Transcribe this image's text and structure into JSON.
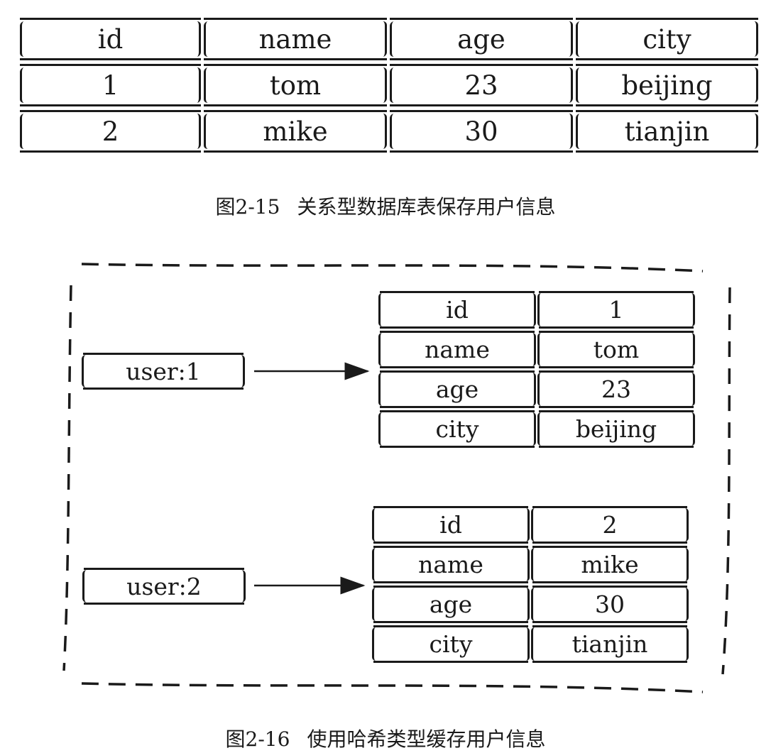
{
  "relational_table": {
    "columns": [
      "id",
      "name",
      "age",
      "city"
    ],
    "rows": [
      [
        "1",
        "tom",
        "23",
        "beijing"
      ],
      [
        "2",
        "mike",
        "30",
        "tianjin"
      ]
    ]
  },
  "caption_15": {
    "number": "图2-15",
    "text": "关系型数据库表保存用户信息"
  },
  "hash": {
    "entries": [
      {
        "key": "user:1",
        "fields": [
          {
            "field": "id",
            "value": "1"
          },
          {
            "field": "name",
            "value": "tom"
          },
          {
            "field": "age",
            "value": "23"
          },
          {
            "field": "city",
            "value": "beijing"
          }
        ]
      },
      {
        "key": "user:2",
        "fields": [
          {
            "field": "id",
            "value": "2"
          },
          {
            "field": "name",
            "value": "mike"
          },
          {
            "field": "age",
            "value": "30"
          },
          {
            "field": "city",
            "value": "tianjin"
          }
        ]
      }
    ]
  },
  "caption_16": {
    "number": "图2-16",
    "text": "使用哈希类型缓存用户信息"
  }
}
